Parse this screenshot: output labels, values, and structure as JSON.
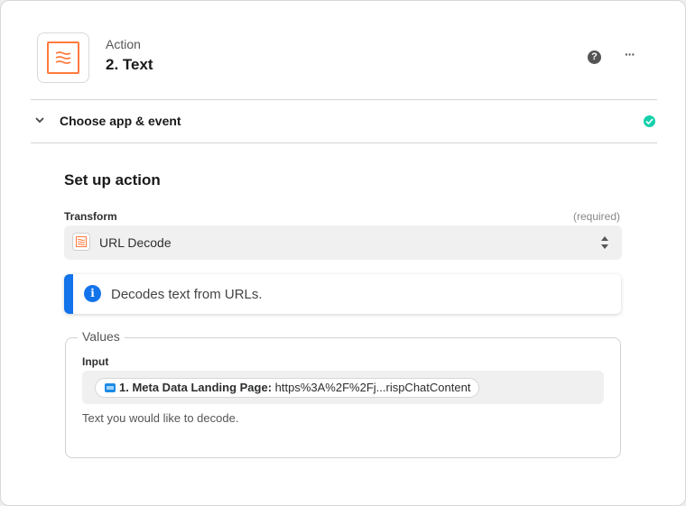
{
  "header": {
    "step_kind": "Action",
    "step_title": "2. Text",
    "app_icon": "text-formatter-icon",
    "help_icon": "question-icon",
    "more_icon": "more-horizontal-icon"
  },
  "choose_section": {
    "title": "Choose app & event",
    "status": "complete",
    "status_color": "#13d0ab"
  },
  "setup": {
    "title": "Set up action",
    "transform": {
      "label": "Transform",
      "required": "(required)",
      "value": "URL Decode"
    },
    "info": {
      "text": "Decodes text from URLs.",
      "accent": "#1273ea"
    },
    "values": {
      "legend": "Values",
      "input_label": "Input",
      "pill_key": "1. Meta Data Landing Page:",
      "pill_value": " https%3A%2F%2Fj...rispChatContent",
      "help": "Text you would like to decode."
    }
  },
  "colors": {
    "brand": "#ff7a3d",
    "accent": "#1273ea",
    "success": "#13d0ab"
  }
}
